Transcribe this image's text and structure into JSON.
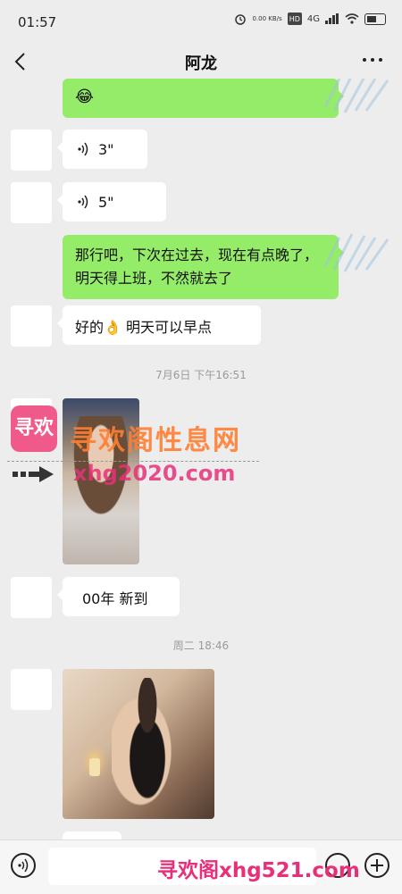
{
  "status": {
    "time": "01:57",
    "net_speed": "0.00\nKB/s",
    "hd_badge": "HD",
    "signal": "4G",
    "battery": "battery-icon"
  },
  "nav": {
    "title": "阿龙"
  },
  "messages": {
    "top_partial": "",
    "top_emoji": "😂",
    "voice1": "3\"",
    "voice2": "5\"",
    "msg_sent": "那行吧，下次在过去，现在有点晚了，明天得上班，不然就去了",
    "msg_reply": "好的👌  明天可以早点",
    "time1": "7月6日  下午16:51",
    "msg_new": "00年  新到",
    "time2": "周二  18:46"
  },
  "watermark": {
    "logo": "寻欢",
    "site": "寻欢阁性息网",
    "url": "xhg2020.com",
    "bottom": "寻欢阁xhg521.com"
  },
  "input": {
    "placeholder": ""
  },
  "colors": {
    "bubble_sent": "#95ec69",
    "bubble_received": "#ffffff",
    "background": "#ededed"
  }
}
